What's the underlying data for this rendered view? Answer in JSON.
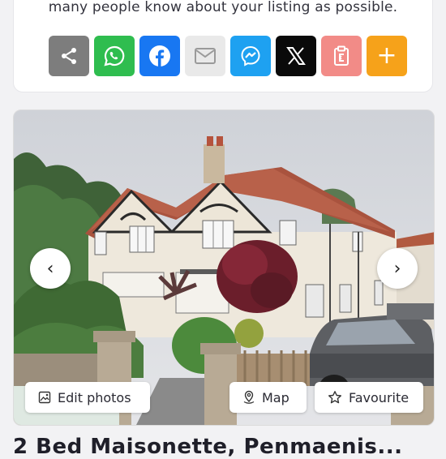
{
  "share": {
    "text": "many people know about your listing as possible.",
    "buttons": [
      {
        "name": "share-icon",
        "bg": "#7d7d7d"
      },
      {
        "name": "whatsapp-icon",
        "bg": "#2fbd4f"
      },
      {
        "name": "facebook-icon",
        "bg": "#1877f2"
      },
      {
        "name": "email-icon",
        "bg": "#e9e9e9"
      },
      {
        "name": "messenger-icon",
        "bg": "#1ea1f1"
      },
      {
        "name": "x-icon",
        "bg": "#0a0a0a"
      },
      {
        "name": "copy-icon",
        "bg": "#f28b87"
      },
      {
        "name": "plus-icon",
        "bg": "#f6a21a",
        "label": "+"
      }
    ]
  },
  "photo": {
    "prev_label": "‹",
    "next_label": "›",
    "edit_photos_label": "Edit photos",
    "map_label": "Map",
    "favourite_label": "Favourite"
  },
  "listing": {
    "title": "2 Bed Maisonette, Penmaenis..."
  }
}
